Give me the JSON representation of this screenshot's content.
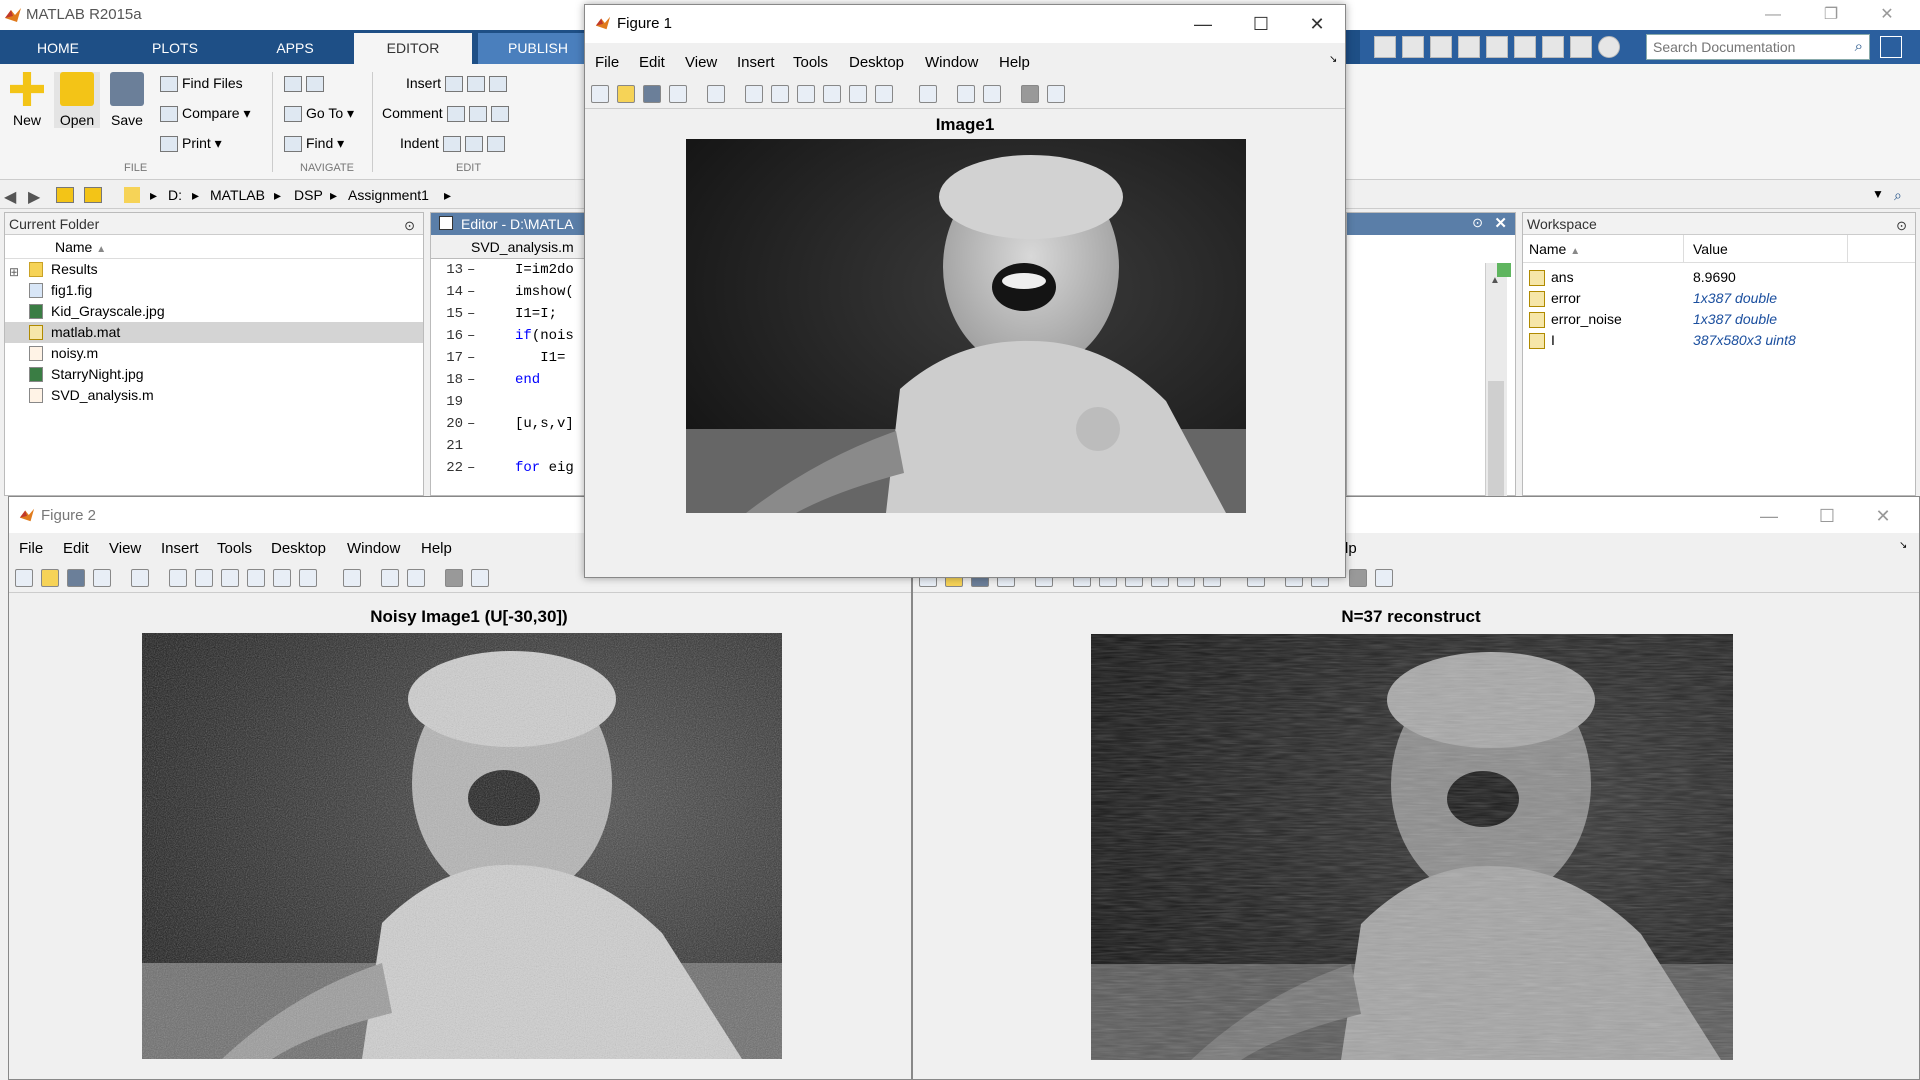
{
  "app": {
    "title": "MATLAB R2015a",
    "tabs": [
      "HOME",
      "PLOTS",
      "APPS",
      "EDITOR",
      "PUBLISH"
    ],
    "search_placeholder": "Search Documentation"
  },
  "ribbon": {
    "file": {
      "new": "New",
      "open": "Open",
      "save": "Save",
      "find_files": "Find Files",
      "compare": "Compare",
      "print": "Print",
      "label": "FILE"
    },
    "navigate": {
      "go_to": "Go To",
      "find": "Find",
      "label": "NAVIGATE"
    },
    "edit": {
      "insert": "Insert",
      "comment": "Comment",
      "indent": "Indent",
      "label": "EDIT"
    }
  },
  "address": {
    "path": [
      "D:",
      "MATLAB",
      "DSP",
      "Assignment1"
    ]
  },
  "current_folder": {
    "title": "Current Folder",
    "column": "Name",
    "items": [
      {
        "name": "Results",
        "type": "folder"
      },
      {
        "name": "fig1.fig",
        "type": "fig"
      },
      {
        "name": "Kid_Grayscale.jpg",
        "type": "image"
      },
      {
        "name": "matlab.mat",
        "type": "mat",
        "selected": true
      },
      {
        "name": "noisy.m",
        "type": "m"
      },
      {
        "name": "StarryNight.jpg",
        "type": "image"
      },
      {
        "name": "SVD_analysis.m",
        "type": "m"
      }
    ]
  },
  "editor": {
    "title": "Editor - D:\\MATLA",
    "tab": "SVD_analysis.m",
    "lines": [
      {
        "n": "13",
        "code": "I=im2do"
      },
      {
        "n": "14",
        "code": "imshow("
      },
      {
        "n": "15",
        "code": "I1=I;"
      },
      {
        "n": "16",
        "kw": "if",
        "code": "(nois"
      },
      {
        "n": "17",
        "code": "   I1="
      },
      {
        "n": "18",
        "kw": "end",
        "code": ""
      },
      {
        "n": "19",
        "code": ""
      },
      {
        "n": "20",
        "code": "[u,s,v]"
      },
      {
        "n": "21",
        "code": ""
      },
      {
        "n": "22",
        "kw": "for",
        "code": " eig"
      }
    ]
  },
  "workspace": {
    "title": "Workspace",
    "columns": [
      "Name",
      "Value"
    ],
    "vars": [
      {
        "name": "ans",
        "value": "8.9690",
        "italic": false
      },
      {
        "name": "error",
        "value": "1x387 double",
        "italic": true
      },
      {
        "name": "error_noise",
        "value": "1x387 double",
        "italic": true
      },
      {
        "name": "I",
        "value": "387x580x3 uint8",
        "italic": true
      }
    ]
  },
  "figure1": {
    "title": "Figure 1",
    "menu": [
      "File",
      "Edit",
      "View",
      "Insert",
      "Tools",
      "Desktop",
      "Window",
      "Help"
    ],
    "caption": "Image1"
  },
  "figure2": {
    "title": "Figure 2",
    "menu": [
      "File",
      "Edit",
      "View",
      "Insert",
      "Tools",
      "Desktop",
      "Window",
      "Help"
    ],
    "caption": "Noisy Image1 (U[-30,30])"
  },
  "figure3": {
    "menu_fragment": "lp",
    "caption": "N=37 reconstruct"
  }
}
